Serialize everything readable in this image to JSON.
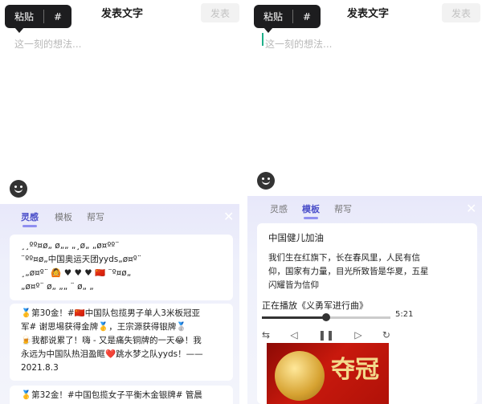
{
  "left": {
    "paste_label": "粘贴",
    "hash_label": "#",
    "title": "发表文字",
    "send_label": "发表",
    "placeholder": "这一刻的想法...",
    "tabs": [
      "灵感",
      "模板",
      "帮写"
    ],
    "active_tab": "灵感",
    "close_icon": "close-icon",
    "card1_lines": [
      "¸¸ºº¤ø„ ø„„ „¸ø„ „ø¤ºº¨",
      "¨ºº¤ø„中国奥运天团yyds„ø¤º¨",
      "¸„ø¤º¨  🙆 ♥ ♥ ♥ 🇨🇳 ¨º¤ø„",
      "„ø¤º¨ ø„ „„ ¨ ø„ „"
    ],
    "card2_lines": [
      "🥇第30金！#🇨🇳中国队包揽男子单人3米板冠亚",
      "军# 谢思埸获得金牌🥇，王宗源获得银牌🥈",
      "🍺我都说累了！嗨 - 又是痛失铜牌的一天😂！我",
      "永远为中国队热泪盈眶❤️跳水梦之队yyds！——",
      "2021.8.3"
    ],
    "card3_lines": [
      "🥇第32金！#中国包揽女子平衡木金银牌# 管晨"
    ]
  },
  "right": {
    "paste_label": "粘贴",
    "hash_label": "#",
    "title": "发表文字",
    "send_label": "发表",
    "placeholder": "这一刻的想法...",
    "tabs": [
      "灵感",
      "模板",
      "帮写"
    ],
    "active_tab": "模板",
    "template_title": "中国健儿加油",
    "template_lines": [
      "我们生在红旗下，长在春风里，人民有信",
      "仰，国家有力量，目光所致皆是华夏，五星",
      "闪耀皆为信仰"
    ],
    "now_playing": "正在播放《义勇军进行曲》",
    "duration": "5:21",
    "progress": 0.5,
    "poster_text": "夺冠"
  },
  "colors": {
    "accent": "#4b4fc9",
    "send_disabled": "#c2c2c2",
    "caret": "#20b08a"
  }
}
